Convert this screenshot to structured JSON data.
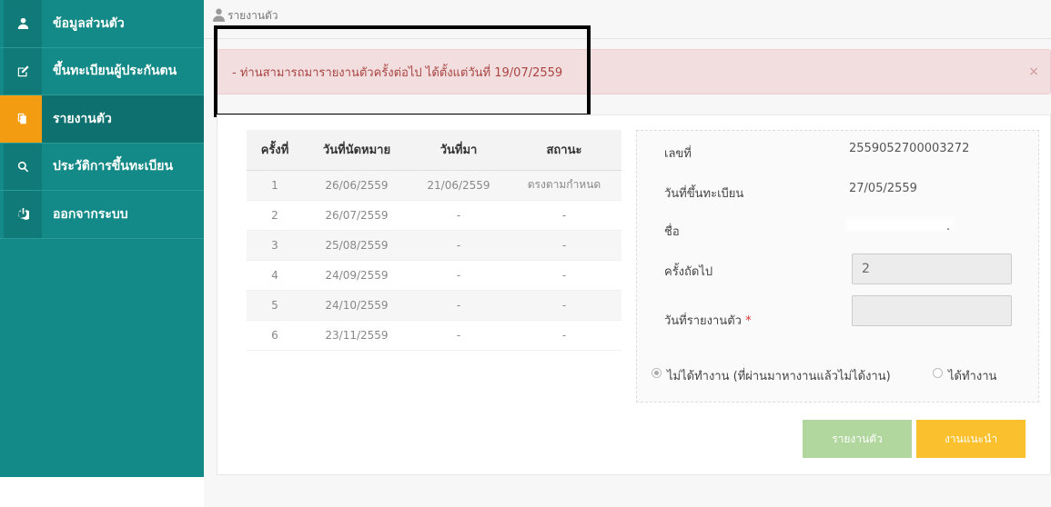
{
  "sidebar": {
    "items": [
      {
        "label": "ข้อมูลส่วนตัว",
        "icon": "user-icon"
      },
      {
        "label": "ขึ้นทะเบียนผู้ประกันตน",
        "icon": "edit-icon"
      },
      {
        "label": "รายงานตัว",
        "icon": "copy-icon"
      },
      {
        "label": "ประวัติการขึ้นทะเบียน",
        "icon": "search-icon"
      },
      {
        "label": "ออกจากระบบ",
        "icon": "power-icon"
      }
    ],
    "active_index": 2,
    "colors": {
      "bg": "#138a87",
      "accent": "#f39c12"
    }
  },
  "breadcrumb": {
    "label": "รายงานตัว"
  },
  "alert": {
    "text": "- ท่านสามารถมารายงานตัวครั้งต่อไป ได้ตั้งแต่วันที่ 19/07/2559",
    "close": "×"
  },
  "table": {
    "headers": [
      "ครั้งที่",
      "วันที่นัดหมาย",
      "วันที่มา",
      "สถานะ"
    ],
    "rows": [
      [
        "1",
        "26/06/2559",
        "21/06/2559",
        "ตรงตามกำหนด"
      ],
      [
        "2",
        "26/07/2559",
        "-",
        "-"
      ],
      [
        "3",
        "25/08/2559",
        "-",
        "-"
      ],
      [
        "4",
        "24/09/2559",
        "-",
        "-"
      ],
      [
        "5",
        "24/10/2559",
        "-",
        "-"
      ],
      [
        "6",
        "23/11/2559",
        "-",
        "-"
      ]
    ]
  },
  "form": {
    "number_label": "เลขที่",
    "number_value": "2559052700003272",
    "register_date_label": "วันที่ขึ้นทะเบียน",
    "register_date_value": "27/05/2559",
    "name_label": "ชื่อ",
    "name_value": ".",
    "next_time_label": "ครั้งถัดไป",
    "next_time_value": "2",
    "report_date_label": "วันที่รายงานตัว",
    "report_date_value": "",
    "required_mark": "*",
    "radio_unemployed": "ไม่ได้ทำงาน (ที่ผ่านมาหางานแล้วไม่ได้งาน)",
    "radio_employed": "ได้ทำงาน"
  },
  "buttons": {
    "report": "รายงานตัว",
    "advice": "งานแนะนำ"
  }
}
